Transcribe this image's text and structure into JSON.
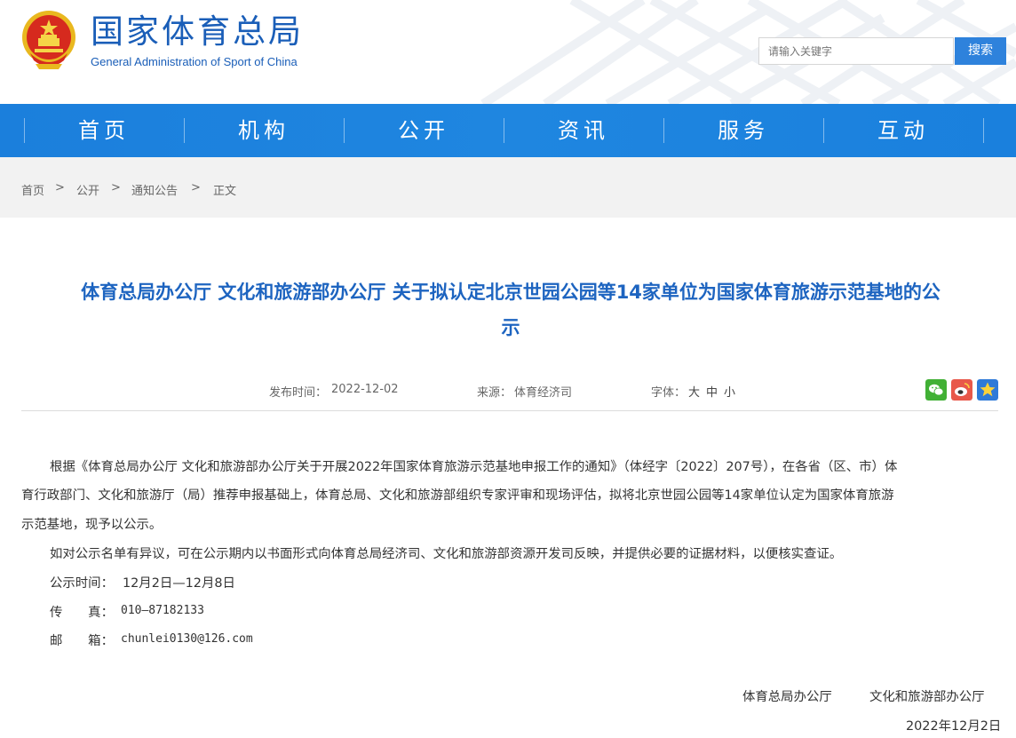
{
  "header": {
    "title_cn": "国家体育总局",
    "title_en": "General Administration of Sport of China",
    "search_placeholder": "请输入关键字",
    "search_button": "搜索"
  },
  "nav": {
    "items": [
      {
        "label": "首页"
      },
      {
        "label": "机构"
      },
      {
        "label": "公开"
      },
      {
        "label": "资讯"
      },
      {
        "label": "服务"
      },
      {
        "label": "互动"
      }
    ]
  },
  "breadcrumb": {
    "items": [
      "首页",
      "公开",
      "通知公告",
      "正文"
    ],
    "separator": ">"
  },
  "article": {
    "title_line1": "体育总局办公厅 文化和旅游部办公厅 关于拟认定北京世园公园等14家单位为国家体育旅游示范基地的公",
    "title_line2": "示",
    "publish_label": "发布时间：",
    "publish_date": "2022-12-02",
    "source_label": "来源：",
    "source": "体育经济司",
    "font_label": "字体：",
    "font_large": "大",
    "font_medium": "中",
    "font_small": "小",
    "share_icons": [
      "wechat-icon",
      "weibo-icon",
      "favorite-icon"
    ],
    "p1_line1": "根据《体育总局办公厅 文化和旅游部办公厅关于开展2022年国家体育旅游示范基地申报工作的通知》（体经字〔2022〕207号），在各省（区、市）体",
    "p1_line2": "育行政部门、文化和旅游厅（局）推荐申报基础上，体育总局、文化和旅游部组织专家评审和现场评估，拟将北京世园公园等14家单位认定为国家体育旅游",
    "p1_line3": "示范基地，现予以公示。",
    "p2": "如对公示名单有异议，可在公示期内以书面形式向体育总局经济司、文化和旅游部资源开发司反映，并提供必要的证据材料，以便核实查证。",
    "period_label": "公示时间：",
    "period_value": "12月2日—12月8日",
    "fax_label": "传　　真：",
    "fax_value": "010—87182133",
    "email_label": "邮　　箱：",
    "email_value": "chunlei0130@126.com",
    "sign_1": "体育总局办公厅",
    "sign_2": "文化和旅游部办公厅",
    "sign_date": "2022年12月2日"
  },
  "colors": {
    "brand_blue": "#1a5eb8",
    "nav_blue": "#1f86e0",
    "title_blue": "#1d64c0",
    "search_button": "#2e82dc",
    "breadcrumb_bg": "#f2f2f2"
  }
}
